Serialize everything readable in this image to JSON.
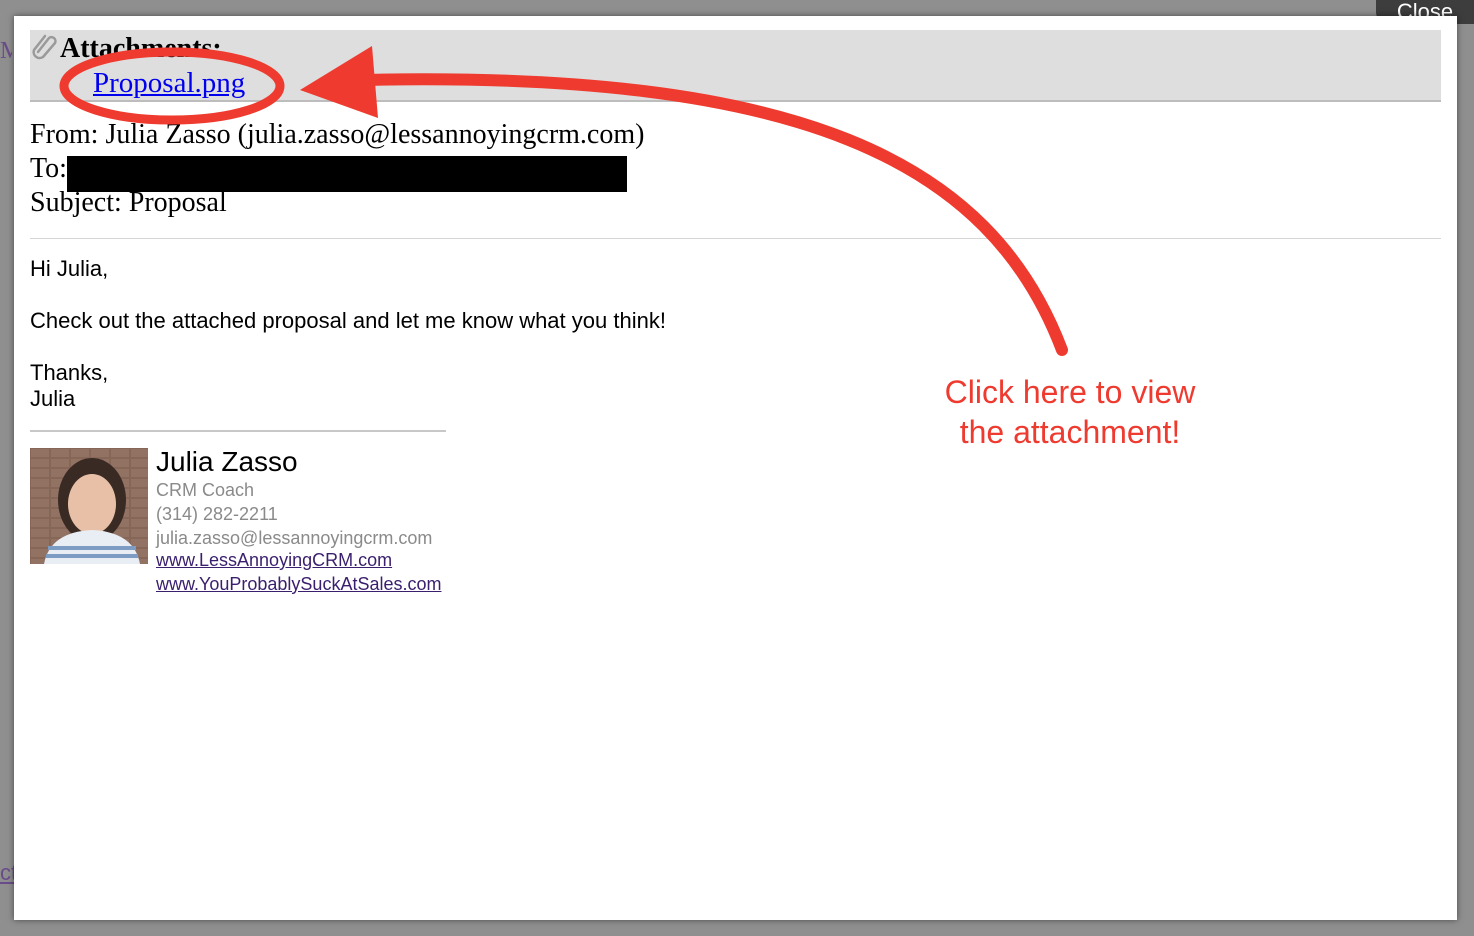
{
  "background": {
    "left_glyph": "M",
    "left_glyph_bottom": "ct"
  },
  "close_button": {
    "label": "Close"
  },
  "attachments": {
    "title": "Attachments:",
    "file_name": "Proposal.png"
  },
  "email_headers": {
    "from": "From: Julia Zasso (julia.zasso@lessannoyingcrm.com)",
    "to_label": "To:",
    "subject": "Subject: Proposal"
  },
  "body": {
    "greeting": "Hi Julia,",
    "message": "Check out the attached proposal and let me know what you think!",
    "closing": "Thanks,",
    "signoff": "Julia"
  },
  "signature": {
    "name": "Julia Zasso",
    "title": "CRM Coach",
    "phone": "(314) 282-2211",
    "email": "julia.zasso@lessannoyingcrm.com",
    "link1": "www.LessAnnoyingCRM.com",
    "link2": "www.YouProbablySuckAtSales.com"
  },
  "annotation": {
    "line1": "Click here to view",
    "line2": "the attachment!",
    "color": "#ef3b2f"
  },
  "icons": [
    "paperclip-icon"
  ]
}
